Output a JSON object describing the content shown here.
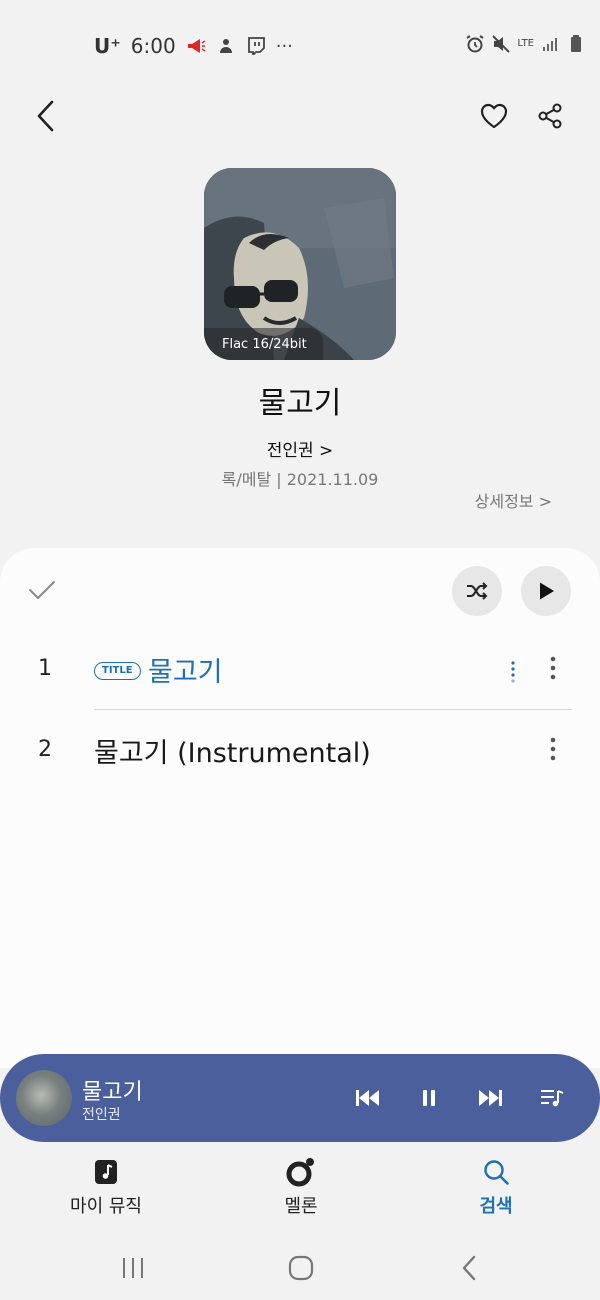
{
  "status_bar": {
    "carrier": "U⁺",
    "time": "6:00",
    "more": "···",
    "network": "LTE"
  },
  "header": {
    "back_icon": "chevron-left-icon",
    "like_icon": "heart-outline-icon",
    "share_icon": "share-icon"
  },
  "album": {
    "quality_badge": "Flac 16/24bit",
    "title": "물고기",
    "artist": "전인권 >",
    "meta": "록/메탈 | 2021.11.09",
    "detail_link": "상세정보 >"
  },
  "track_list": {
    "tracks": [
      {
        "number": "1",
        "badge": "TITLE",
        "name": "물고기",
        "playing": true
      },
      {
        "number": "2",
        "badge": "",
        "name": "물고기 (Instrumental)",
        "playing": false
      }
    ]
  },
  "mini_player": {
    "title": "물고기",
    "artist": "전인권",
    "accent_color": "#4a5f9c"
  },
  "bottom_nav": {
    "items": [
      {
        "label": "마이 뮤직",
        "icon": "music-note-icon"
      },
      {
        "label": "멜론",
        "icon": "melon-icon"
      },
      {
        "label": "검색",
        "icon": "search-icon",
        "active": true
      }
    ]
  },
  "colors": {
    "accent": "#1f6fb8",
    "background": "#f2f2f2",
    "player": "#4a5f9c"
  }
}
